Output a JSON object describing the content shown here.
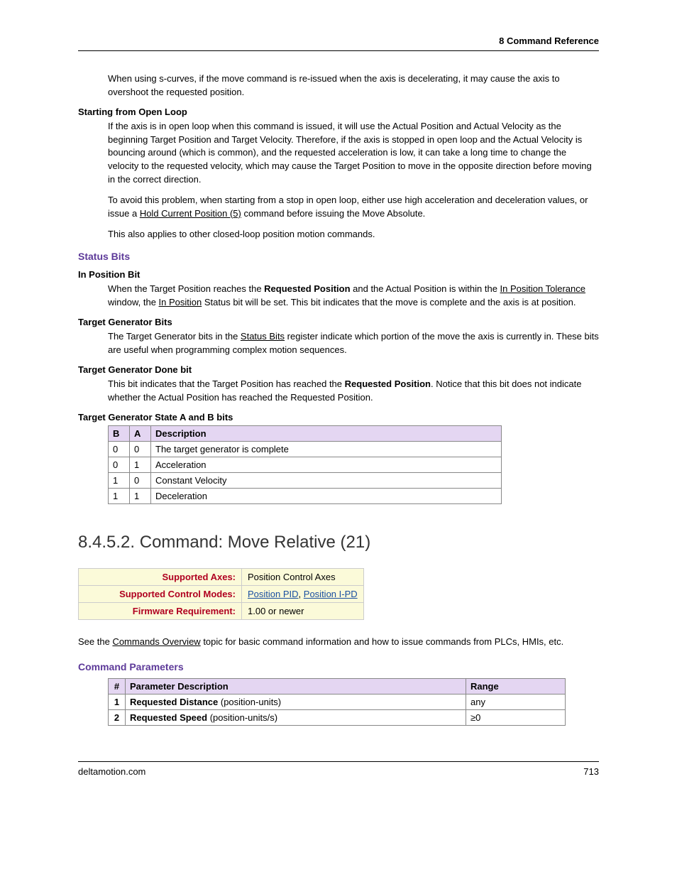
{
  "header": {
    "chapter": "8  Command Reference"
  },
  "p1": "When using s-curves, if the move command is re-issued when the axis is decelerating, it may cause the axis to overshoot the requested position.",
  "h_openloop": "Starting from Open Loop",
  "p2": "If the axis is in open loop when this command is issued, it will use the Actual Position and Actual Velocity as the beginning Target Position and Target Velocity. Therefore, if the axis is stopped in open loop and the Actual Velocity is bouncing around (which is common), and the requested acceleration is low, it can take a long time to change the velocity to the requested velocity, which may cause the Target Position to move in the opposite direction before moving in the correct direction.",
  "p3a": "To avoid this problem, when starting from a stop in open loop, either use high acceleration and deceleration values, or issue a ",
  "p3_link": "Hold Current Position (5)",
  "p3b": " command before issuing the Move Absolute.",
  "p4": "This also applies to other closed-loop position motion commands.",
  "h_status": "Status Bits",
  "h_inpos": "In Position Bit",
  "p5a": "When the Target Position reaches the ",
  "p5_bold1": "Requested Position",
  "p5b": " and the Actual Position is within the ",
  "p5_link1": "In Position Tolerance",
  "p5c": " window, the ",
  "p5_link2": "In Position",
  "p5d": " Status bit will be set. This bit indicates that the move is complete and the axis is at position.",
  "h_tgbits": "Target Generator Bits",
  "p6a": "The Target Generator bits in the ",
  "p6_link": "Status Bits",
  "p6b": " register indicate which portion of the move the axis is currently in. These bits are useful when programming complex motion sequences.",
  "h_tgdone": "Target Generator Done bit",
  "p7a": "This bit indicates that the Target Position has reached the ",
  "p7_bold": "Requested Position",
  "p7b": ". Notice that this bit does not indicate whether the Actual Position has reached the Requested Position.",
  "h_tgab": "Target Generator State A and B bits",
  "state_table": {
    "headers": {
      "b": "B",
      "a": "A",
      "desc": "Description"
    },
    "rows": [
      {
        "b": "0",
        "a": "0",
        "desc": "The target generator is complete"
      },
      {
        "b": "0",
        "a": "1",
        "desc": "Acceleration"
      },
      {
        "b": "1",
        "a": "0",
        "desc": "Constant Velocity"
      },
      {
        "b": "1",
        "a": "1",
        "desc": "Deceleration"
      }
    ]
  },
  "h_cmd": "8.4.5.2. Command: Move Relative (21)",
  "info": {
    "axes_label": "Supported Axes:",
    "axes_value": "Position Control Axes",
    "modes_label": "Supported Control Modes:",
    "modes_link1": "Position PID",
    "modes_sep": ", ",
    "modes_link2": "Position I-PD",
    "fw_label": "Firmware Requirement:",
    "fw_value": "1.00 or newer"
  },
  "p8a": "See the ",
  "p8_link": "Commands Overview",
  "p8b": " topic for basic command information and how to issue commands from PLCs, HMIs, etc.",
  "h_params": "Command Parameters",
  "param_table": {
    "headers": {
      "n": "#",
      "desc": "Parameter Description",
      "range": "Range"
    },
    "rows": [
      {
        "n": "1",
        "name": "Requested Distance",
        "units": " (position-units)",
        "range": "any"
      },
      {
        "n": "2",
        "name": "Requested Speed",
        "units": "  (position-units/s)",
        "range": "≥0"
      }
    ]
  },
  "footer": {
    "left": "deltamotion.com",
    "right": "713"
  }
}
